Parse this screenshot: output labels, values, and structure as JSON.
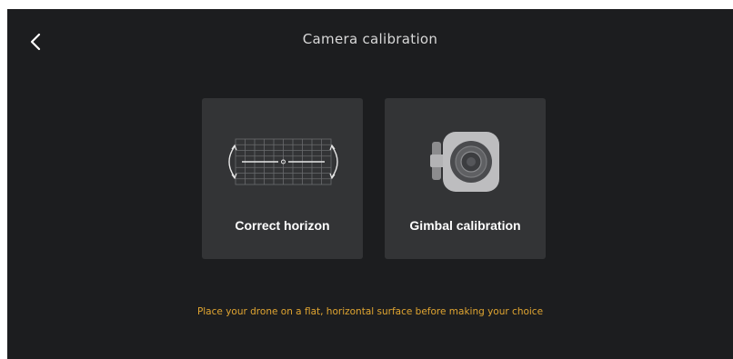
{
  "header": {
    "title": "Camera calibration",
    "back_icon": "chevron-left-icon"
  },
  "options": [
    {
      "label": "Correct horizon",
      "icon": "horizon-grid-icon"
    },
    {
      "label": "Gimbal calibration",
      "icon": "gimbal-camera-icon"
    }
  ],
  "hint": "Place your drone on a flat, horizontal surface before making your choice",
  "colors": {
    "background": "#1c1d1f",
    "card": "#333436",
    "hint": "#e0a531",
    "text": "#ffffff"
  }
}
